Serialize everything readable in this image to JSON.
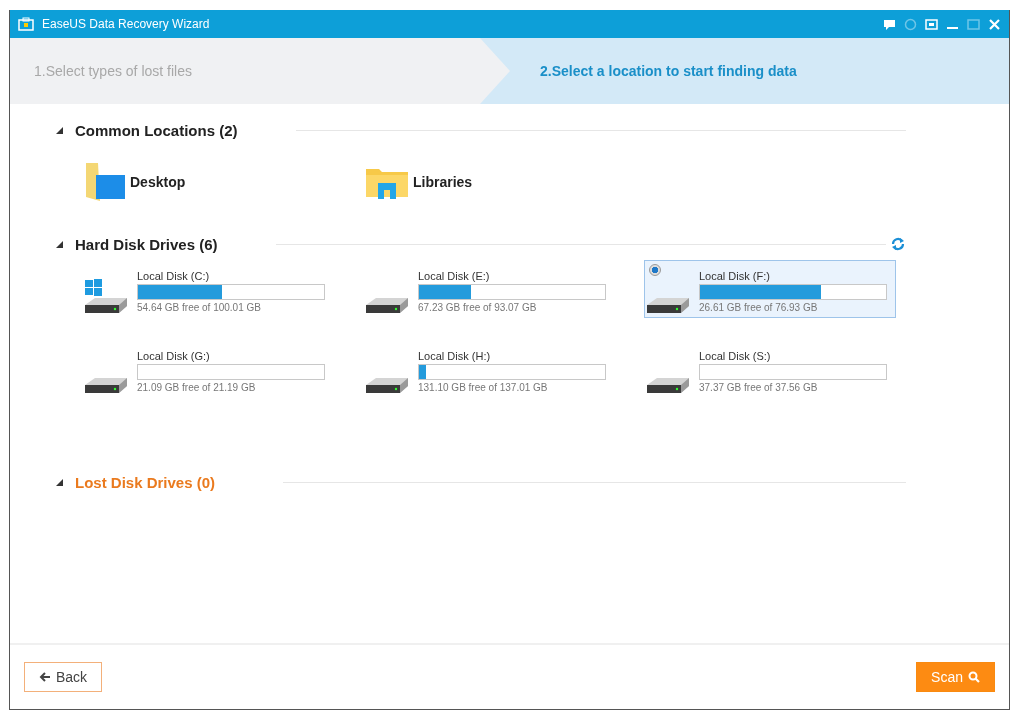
{
  "window": {
    "title": "EaseUS Data Recovery Wizard"
  },
  "steps": [
    {
      "label": "1.Select types of lost files",
      "selected": false
    },
    {
      "label": "2.Select a location to start finding data",
      "selected": true
    }
  ],
  "common_locations": {
    "title": "Common Locations (2)",
    "items": [
      {
        "label": "Desktop",
        "kind": "desktop"
      },
      {
        "label": "Libraries",
        "kind": "libraries"
      }
    ]
  },
  "hard_disk_drives": {
    "title": "Hard Disk Drives (6)",
    "drives": [
      {
        "name": "Local Disk (C:)",
        "level": 0.45,
        "reading": "54.64 GB free of 100.01 GB",
        "system": true,
        "selected": false
      },
      {
        "name": "Local Disk (E:)",
        "level": 0.28,
        "reading": "67.23 GB free of 93.07 GB",
        "system": false,
        "selected": false
      },
      {
        "name": "Local Disk (F:)",
        "level": 0.65,
        "reading": "26.61 GB free of 76.93 GB",
        "system": false,
        "selected": true
      },
      {
        "name": "Local Disk (G:)",
        "level": 0.0,
        "reading": "21.09 GB free of 21.19 GB",
        "system": false,
        "selected": false
      },
      {
        "name": "Local Disk (H:)",
        "level": 0.04,
        "reading": "131.10 GB free of 137.01 GB",
        "system": false,
        "selected": false
      },
      {
        "name": "Local Disk (S:)",
        "level": 0.0,
        "reading": "37.37 GB free of 37.56 GB",
        "system": false,
        "selected": false
      }
    ]
  },
  "lost_disk_drives": {
    "title": "Lost Disk Drives (0)"
  },
  "buttons": {
    "back": "Back",
    "scan": "Scan"
  }
}
